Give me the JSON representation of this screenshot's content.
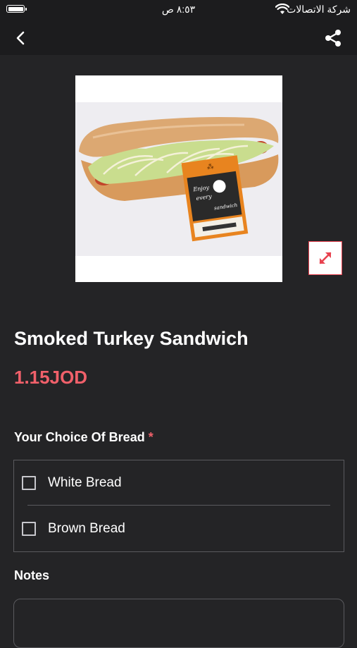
{
  "status_bar": {
    "time": "٨:٥٣ ص",
    "carrier": "شركة الاتصالات"
  },
  "nav": {
    "back_icon": "chevron-left-icon",
    "share_icon": "share-icon"
  },
  "product": {
    "name": "Smoked Turkey Sandwich",
    "price": "1.15JOD",
    "image_label_lines": [
      "Enjoy",
      "every",
      "sandwich"
    ]
  },
  "bread_choice": {
    "label": "Your Choice Of Bread",
    "required_mark": "*",
    "options": [
      {
        "label": "White Bread",
        "checked": false
      },
      {
        "label": "Brown Bread",
        "checked": false
      }
    ]
  },
  "notes": {
    "label": "Notes",
    "value": ""
  },
  "colors": {
    "accent": "#f0606a",
    "expand_icon": "#e8424f",
    "background": "#242426",
    "bar": "#1c1c1e"
  }
}
